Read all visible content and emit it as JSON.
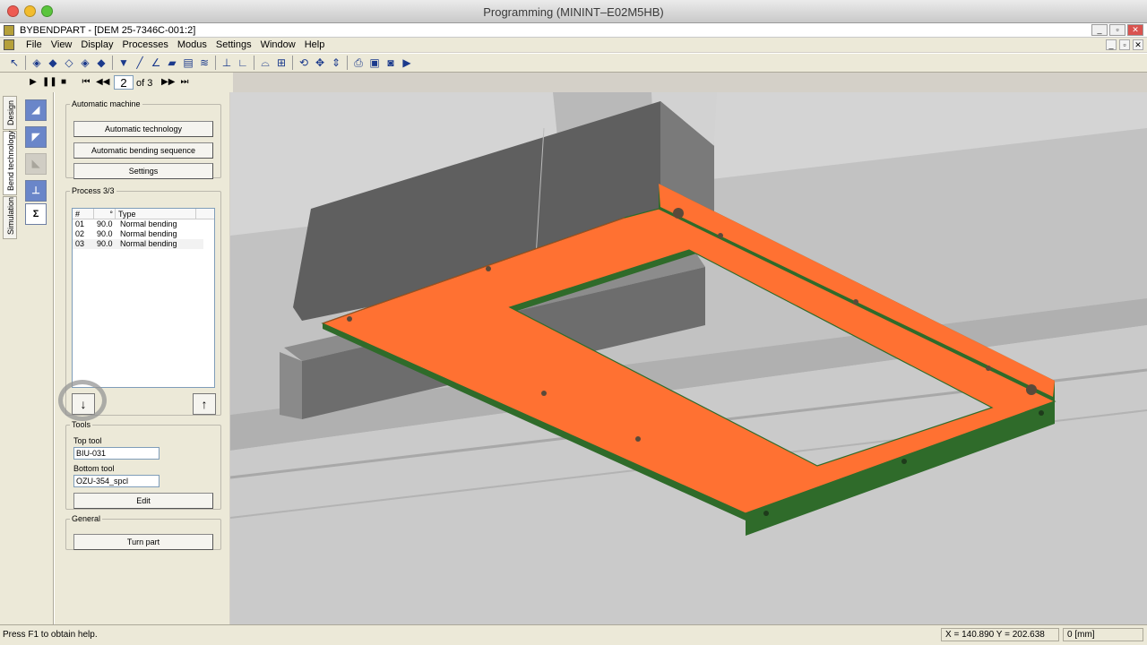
{
  "window": {
    "title": "Programming (MININT–E02M5HB)",
    "app_title": "BYBENDPART - [DEM 25-7346C-001:2]"
  },
  "menu": [
    "File",
    "View",
    "Display",
    "Processes",
    "Modus",
    "Settings",
    "Window",
    "Help"
  ],
  "sim": {
    "step": "2",
    "of_label": "of 3"
  },
  "vtabs": [
    "Design",
    "Bend technology",
    "Simulation"
  ],
  "auto_machine": {
    "legend": "Automatic machine",
    "btn_tech": "Automatic technology",
    "btn_seq": "Automatic bending sequence",
    "btn_settings": "Settings"
  },
  "process": {
    "legend": "Process 3/3",
    "col_num": "#",
    "col_angle": "°",
    "col_type": "Type",
    "rows": [
      {
        "num": "01",
        "angle": "90.0",
        "type": "Normal bending"
      },
      {
        "num": "02",
        "angle": "90.0",
        "type": "Normal bending"
      },
      {
        "num": "03",
        "angle": "90.0",
        "type": "Normal bending"
      }
    ]
  },
  "tools": {
    "legend": "Tools",
    "top_label": "Top tool",
    "top_value": "BIU-031",
    "bottom_label": "Bottom tool",
    "bottom_value": "OZU-354_spcl",
    "edit": "Edit"
  },
  "general": {
    "legend": "General",
    "turn": "Turn part"
  },
  "status": {
    "help": "Press F1 to obtain help.",
    "coords": "X = 140.890   Y = 202.638",
    "unit": "0 [mm]"
  },
  "colors": {
    "part_face": "#ff7132",
    "part_edge": "#2f6b2a",
    "machine_dark": "#6f6f6f"
  }
}
